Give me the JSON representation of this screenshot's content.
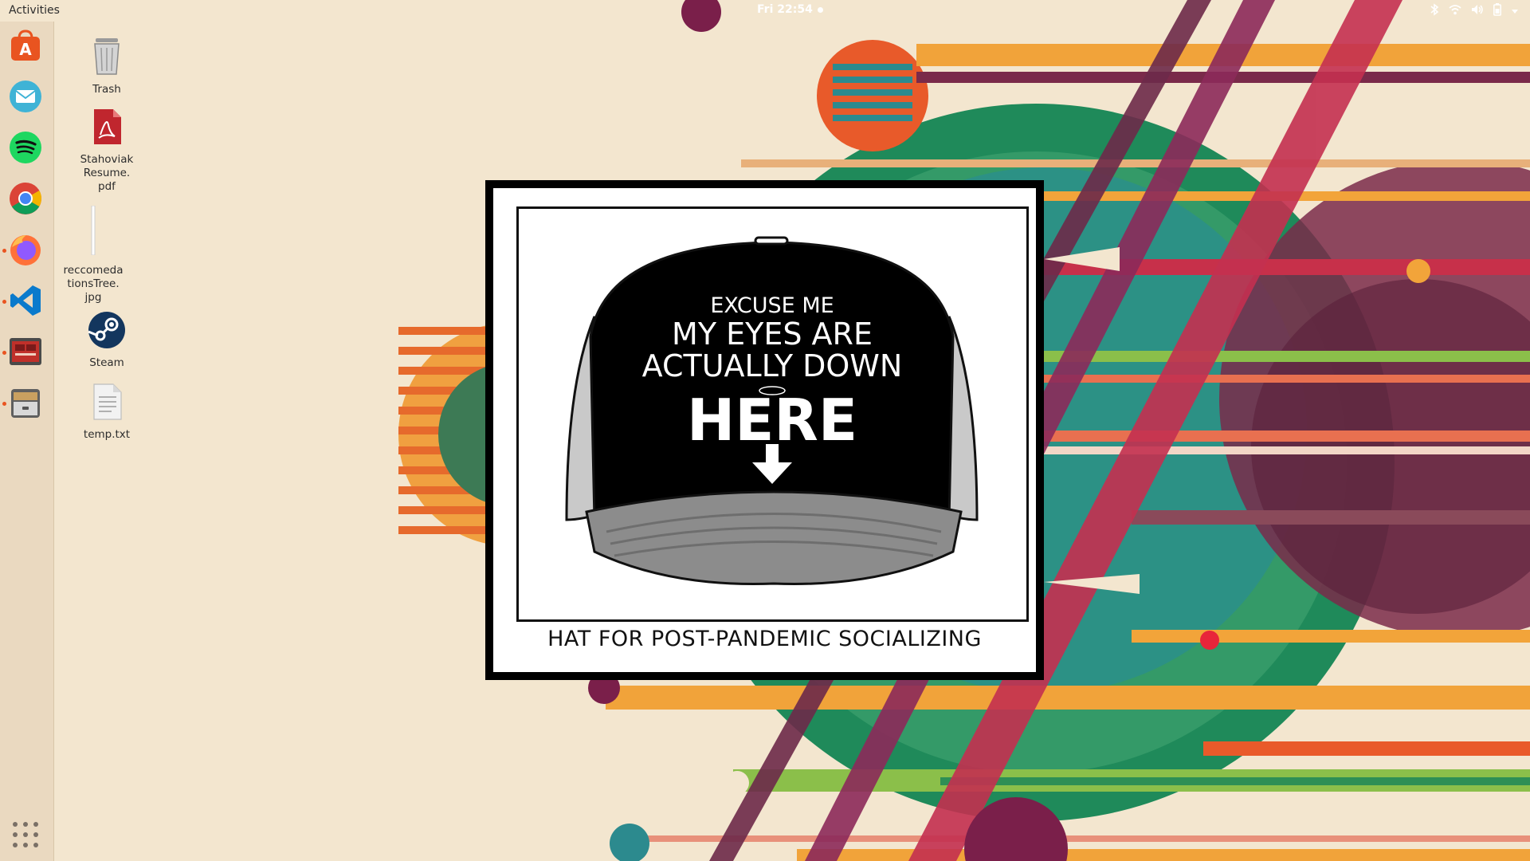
{
  "topbar": {
    "activities_label": "Activities",
    "clock": "Fri 22:54",
    "tray_icons": [
      "bluetooth-icon",
      "wifi-icon",
      "volume-icon",
      "battery-icon",
      "chevron-down-icon"
    ]
  },
  "dock": {
    "items": [
      {
        "name": "ubuntu-software",
        "icon": "shopping-bag-icon",
        "running": false
      },
      {
        "name": "mail",
        "icon": "envelope-icon",
        "running": false
      },
      {
        "name": "spotify",
        "icon": "spotify-icon",
        "running": false
      },
      {
        "name": "chrome",
        "icon": "chrome-icon",
        "running": false
      },
      {
        "name": "firefox",
        "icon": "firefox-icon",
        "running": true
      },
      {
        "name": "vscode",
        "icon": "vscode-icon",
        "running": true
      },
      {
        "name": "screenshot-app",
        "icon": "presentation-icon",
        "running": true
      },
      {
        "name": "files",
        "icon": "file-cabinet-icon",
        "running": true
      }
    ],
    "show_apps_icon": "grid-icon"
  },
  "desktop": {
    "icons": [
      {
        "label": "Trash",
        "icon": "trash-icon"
      },
      {
        "label": "Stahoviak\nResume.\npdf",
        "icon": "pdf-icon"
      },
      {
        "label": "reccomeda\ntionsTree.\njpg",
        "icon": "image-file-icon"
      },
      {
        "label": "Steam",
        "icon": "steam-icon"
      },
      {
        "label": "temp.txt",
        "icon": "text-file-icon"
      }
    ]
  },
  "comic": {
    "hat_line1": "EXCUSE ME",
    "hat_line2": "MY EYES ARE",
    "hat_line3": "ACTUALLY DOWN",
    "hat_line4": "HERE",
    "caption": "HAT FOR POST-PANDEMIC SOCIALIZING"
  },
  "colors": {
    "wallpaper_bg": "#f3e6cf",
    "dock_bg": "#ead9c0",
    "accent_orange": "#e95420"
  }
}
